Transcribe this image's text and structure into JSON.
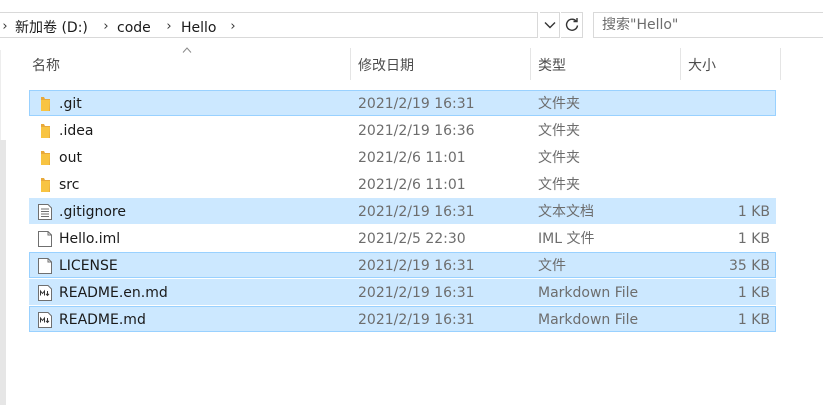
{
  "breadcrumb": {
    "items": [
      {
        "label": "新加卷 (D:)"
      },
      {
        "label": "code"
      },
      {
        "label": "Hello"
      }
    ]
  },
  "search": {
    "placeholder": "搜索\"Hello\""
  },
  "columns": {
    "name": "名称",
    "date": "修改日期",
    "type": "类型",
    "size": "大小"
  },
  "files": [
    {
      "name": ".git",
      "date": "2021/2/19 16:31",
      "type": "文件夹",
      "size": "",
      "icon": "folder-icon",
      "selected": true
    },
    {
      "name": ".idea",
      "date": "2021/2/19 16:36",
      "type": "文件夹",
      "size": "",
      "icon": "folder-icon",
      "selected": false
    },
    {
      "name": "out",
      "date": "2021/2/6 11:01",
      "type": "文件夹",
      "size": "",
      "icon": "folder-icon",
      "selected": false
    },
    {
      "name": "src",
      "date": "2021/2/6 11:01",
      "type": "文件夹",
      "size": "",
      "icon": "folder-icon",
      "selected": false
    },
    {
      "name": ".gitignore",
      "date": "2021/2/19 16:31",
      "type": "文本文档",
      "size": "1 KB",
      "icon": "text-document-icon",
      "selected": true
    },
    {
      "name": "Hello.iml",
      "date": "2021/2/5 22:30",
      "type": "IML 文件",
      "size": "1 KB",
      "icon": "blank-file-icon",
      "selected": false
    },
    {
      "name": "LICENSE",
      "date": "2021/2/19 16:31",
      "type": "文件",
      "size": "35 KB",
      "icon": "blank-file-icon",
      "selected": true
    },
    {
      "name": "README.en.md",
      "date": "2021/2/19 16:31",
      "type": "Markdown File",
      "size": "1 KB",
      "icon": "markdown-file-icon",
      "selected": true
    },
    {
      "name": "README.md",
      "date": "2021/2/19 16:31",
      "type": "Markdown File",
      "size": "1 KB",
      "icon": "markdown-file-icon",
      "selected": true
    }
  ],
  "colors": {
    "selection": "#cce8ff",
    "selection_border": "#99d1ff",
    "folder": "#f8c442"
  }
}
